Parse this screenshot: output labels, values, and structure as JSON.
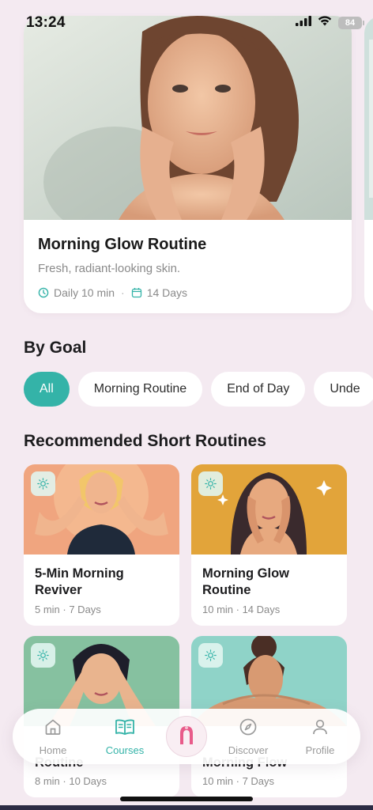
{
  "status_bar": {
    "time": "13:24",
    "battery": "84"
  },
  "featured": {
    "title": "Morning Glow Routine",
    "subtitle": "Fresh, radiant-looking skin.",
    "duration": "Daily 10 min",
    "days": "14 Days"
  },
  "by_goal": {
    "title": "By Goal",
    "chips": [
      {
        "label": "All",
        "active": true
      },
      {
        "label": "Morning Routine",
        "active": false
      },
      {
        "label": "End of Day",
        "active": false
      },
      {
        "label": "Unde",
        "active": false
      }
    ]
  },
  "recommended": {
    "title": "Recommended Short Routines",
    "cards": [
      {
        "title": "5-Min Morning Reviver",
        "meta": "5 min · 7 Days",
        "icon": "sun-icon"
      },
      {
        "title": "Morning Glow Routine",
        "meta": "10 min · 14 Days",
        "icon": "sun-icon"
      },
      {
        "title": "Routine",
        "meta": "8 min · 10 Days",
        "icon": "sun-icon"
      },
      {
        "title": "Morning Flow",
        "meta": "10 min · 7 Days",
        "icon": "sun-icon"
      }
    ]
  },
  "nav": {
    "items": [
      {
        "label": "Home",
        "icon": "home-icon",
        "active": false
      },
      {
        "label": "Courses",
        "icon": "book-icon",
        "active": true
      },
      {
        "label": "Discover",
        "icon": "compass-icon",
        "active": false
      },
      {
        "label": "Profile",
        "icon": "person-icon",
        "active": false
      }
    ],
    "center_icon": "face-tool-icon"
  },
  "colors": {
    "accent": "#34b3a8",
    "background": "#f4eaf1",
    "card": "#ffffff"
  }
}
